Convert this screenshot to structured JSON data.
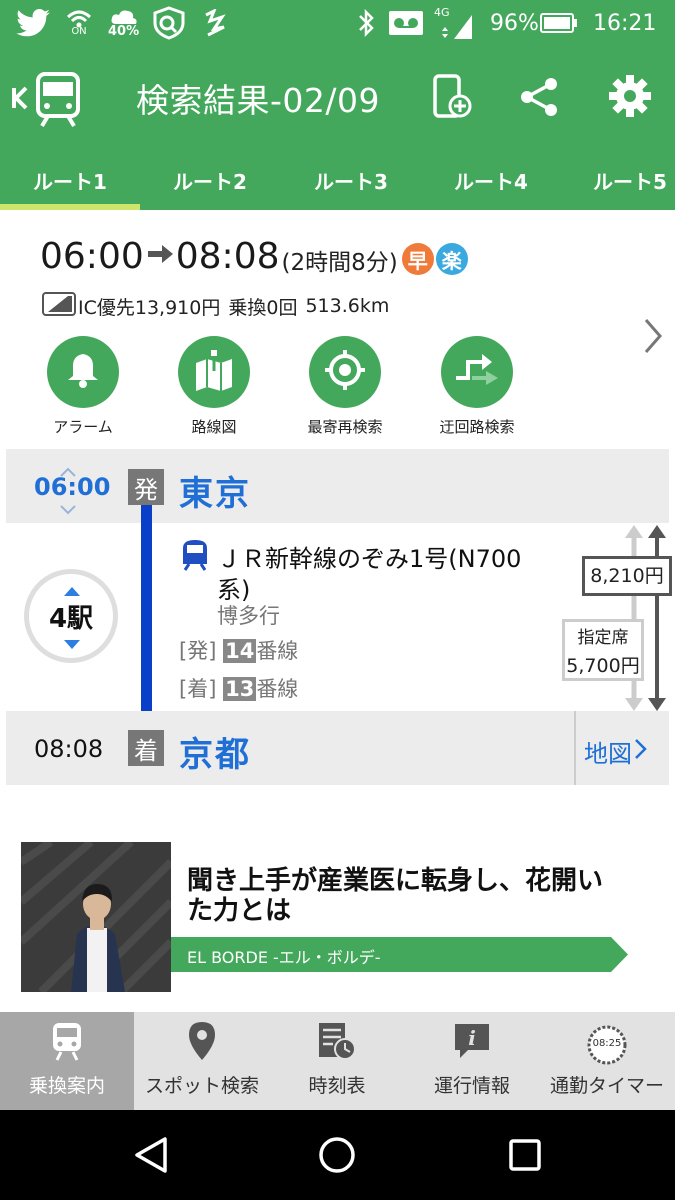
{
  "statusbar": {
    "network_label": "ON",
    "weather_label": "40%",
    "signal_label": "4G",
    "battery": "96%",
    "time": "16:21",
    "icons": [
      "twitter-icon",
      "wifi-icon",
      "weather-icon",
      "shield-icon",
      "app-icon",
      "bluetooth-icon",
      "voicemail-icon",
      "signal-icon",
      "battery-icon"
    ]
  },
  "appbar": {
    "title": "検索結果-02/09",
    "icons": [
      "back-train-icon",
      "add-to-phone-icon",
      "share-icon",
      "settings-icon"
    ]
  },
  "tabs": [
    {
      "label": "ルート1",
      "active": true
    },
    {
      "label": "ルート2",
      "active": false
    },
    {
      "label": "ルート3",
      "active": false
    },
    {
      "label": "ルート4",
      "active": false
    },
    {
      "label": "ルート5",
      "active": false
    }
  ],
  "summary": {
    "depart": "06:00",
    "arrive": "08:08",
    "duration": "(2時間8分)",
    "badge_fast": "早",
    "badge_easy": "楽",
    "ic_label": "IC優先",
    "fare": "13,910円",
    "transfers": "乗換0回",
    "distance": "513.6km"
  },
  "actions": [
    {
      "label": "アラーム",
      "icon": "bell-icon"
    },
    {
      "label": "路線図",
      "icon": "route-map-icon"
    },
    {
      "label": "最寄再検索",
      "icon": "target-icon"
    },
    {
      "label": "迂回路検索",
      "icon": "detour-icon"
    }
  ],
  "route": {
    "depart_time": "06:00",
    "depart_badge": "発",
    "depart_station": "東京",
    "stops": "4駅",
    "train_name_1": "ＪＲ新幹線のぞみ1号(N700",
    "train_name_2": "系)",
    "destination": "博多行",
    "dep_label": "[発]",
    "dep_platform": "14",
    "arr_label": "[着]",
    "arr_platform": "13",
    "platform_suffix": "番線",
    "total_fare": "8,210円",
    "seat_type": "指定席",
    "seat_fare": "5,700円",
    "arrive_time": "08:08",
    "arrive_badge": "着",
    "arrive_station": "京都",
    "map_label": "地図"
  },
  "ad": {
    "headline_1": "聞き上手が産業医に転身し、花開い",
    "headline_2": "た力とは",
    "source": "EL BORDE -エル・ボルデ-"
  },
  "bottomnav": [
    {
      "label": "乗換案内",
      "icon": "train-icon",
      "active": true
    },
    {
      "label": "スポット検索",
      "icon": "location-pin-icon",
      "active": false
    },
    {
      "label": "時刻表",
      "icon": "timetable-icon",
      "active": false
    },
    {
      "label": "運行情報",
      "icon": "info-icon",
      "active": false
    },
    {
      "label": "通勤タイマー",
      "icon": "timer-icon",
      "timer_text": "08:25",
      "active": false
    }
  ],
  "colors": {
    "brand": "#44a85c",
    "link": "#1f6fd6",
    "tab_indicator": "#cde56a",
    "line": "#0a3fc8"
  }
}
